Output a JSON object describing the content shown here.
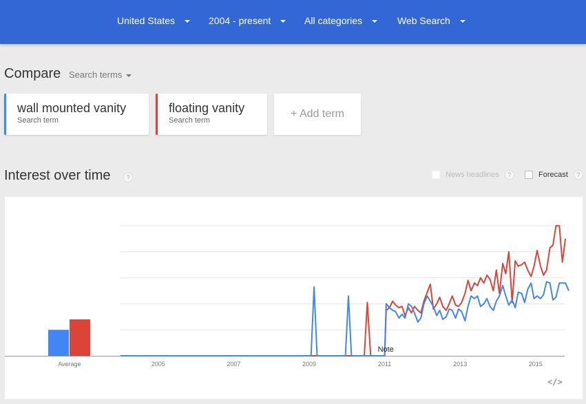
{
  "header": {
    "filters": [
      {
        "label": "United States",
        "name": "filter-region"
      },
      {
        "label": "2004 - present",
        "name": "filter-time"
      },
      {
        "label": "All categories",
        "name": "filter-category"
      },
      {
        "label": "Web Search",
        "name": "filter-property"
      }
    ],
    "background_color": "#3367d6"
  },
  "compare": {
    "title": "Compare",
    "type_label": "Search terms",
    "terms": [
      {
        "name": "wall mounted vanity",
        "sub": "Search term",
        "color": "#4285f4"
      },
      {
        "name": "floating vanity",
        "sub": "Search term",
        "color": "#db4437"
      }
    ],
    "add_term_label": "+ Add term"
  },
  "interest": {
    "title": "Interest over time",
    "help": "?",
    "news_headlines_label": "News headlines",
    "forecast_label": "Forecast",
    "embed_label": "</>",
    "note_label": "Note"
  },
  "chart_data": {
    "type": "line",
    "title": "Interest over time",
    "xlabel": "",
    "ylabel": "",
    "ylim": [
      0,
      100
    ],
    "x_start": 2004.0,
    "x_end": 2015.8,
    "xticks": [
      "2005",
      "2007",
      "2009",
      "2011",
      "2013",
      "2015"
    ],
    "xtick_values": [
      2005,
      2007,
      2009,
      2011,
      2013,
      2015
    ],
    "grid": true,
    "gridline_values": [
      20,
      40,
      60,
      80,
      100
    ],
    "average": {
      "label": "Average",
      "values": [
        {
          "name": "wall mounted vanity",
          "value": 20
        },
        {
          "name": "floating vanity",
          "value": 28
        }
      ]
    },
    "series": [
      {
        "name": "wall mounted vanity",
        "color": "#4285f4",
        "points": [
          [
            2004.0,
            0
          ],
          [
            2009.05,
            0
          ],
          [
            2009.13,
            53
          ],
          [
            2009.21,
            0
          ],
          [
            2009.96,
            0
          ],
          [
            2010.04,
            46
          ],
          [
            2010.12,
            0
          ],
          [
            2011.0,
            0
          ],
          [
            2011.04,
            40
          ],
          [
            2011.13,
            37
          ],
          [
            2011.21,
            35
          ],
          [
            2011.29,
            34
          ],
          [
            2011.38,
            29
          ],
          [
            2011.46,
            32
          ],
          [
            2011.54,
            29
          ],
          [
            2011.63,
            40
          ],
          [
            2011.71,
            38
          ],
          [
            2011.79,
            33
          ],
          [
            2011.88,
            26
          ],
          [
            2011.96,
            29
          ],
          [
            2012.04,
            40
          ],
          [
            2012.13,
            46
          ],
          [
            2012.21,
            42
          ],
          [
            2012.29,
            38
          ],
          [
            2012.38,
            31
          ],
          [
            2012.46,
            35
          ],
          [
            2012.54,
            28
          ],
          [
            2012.63,
            30
          ],
          [
            2012.71,
            36
          ],
          [
            2012.79,
            35
          ],
          [
            2012.88,
            29
          ],
          [
            2012.96,
            36
          ],
          [
            2013.04,
            34
          ],
          [
            2013.13,
            27
          ],
          [
            2013.21,
            38
          ],
          [
            2013.29,
            46
          ],
          [
            2013.38,
            44
          ],
          [
            2013.46,
            46
          ],
          [
            2013.54,
            38
          ],
          [
            2013.63,
            40
          ],
          [
            2013.71,
            44
          ],
          [
            2013.79,
            38
          ],
          [
            2013.88,
            35
          ],
          [
            2013.96,
            42
          ],
          [
            2014.04,
            46
          ],
          [
            2014.13,
            54
          ],
          [
            2014.21,
            46
          ],
          [
            2014.29,
            39
          ],
          [
            2014.38,
            43
          ],
          [
            2014.46,
            37
          ],
          [
            2014.54,
            49
          ],
          [
            2014.63,
            48
          ],
          [
            2014.71,
            41
          ],
          [
            2014.79,
            51
          ],
          [
            2014.88,
            56
          ],
          [
            2014.96,
            44
          ],
          [
            2015.04,
            46
          ],
          [
            2015.13,
            44
          ],
          [
            2015.21,
            47
          ],
          [
            2015.29,
            57
          ],
          [
            2015.38,
            56
          ],
          [
            2015.46,
            43
          ],
          [
            2015.54,
            45
          ],
          [
            2015.63,
            56
          ],
          [
            2015.71,
            56
          ],
          [
            2015.79,
            56
          ],
          [
            2015.88,
            50
          ]
        ]
      },
      {
        "name": "floating vanity",
        "color": "#db4437",
        "points": [
          [
            2004.0,
            0
          ],
          [
            2010.46,
            0
          ],
          [
            2010.54,
            41
          ],
          [
            2010.63,
            0
          ],
          [
            2011.0,
            0
          ],
          [
            2011.04,
            35
          ],
          [
            2011.13,
            37
          ],
          [
            2011.21,
            42
          ],
          [
            2011.29,
            39
          ],
          [
            2011.38,
            37
          ],
          [
            2011.46,
            38
          ],
          [
            2011.54,
            31
          ],
          [
            2011.63,
            37
          ],
          [
            2011.71,
            33
          ],
          [
            2011.79,
            38
          ],
          [
            2011.88,
            35
          ],
          [
            2011.96,
            33
          ],
          [
            2012.04,
            42
          ],
          [
            2012.13,
            49
          ],
          [
            2012.21,
            55
          ],
          [
            2012.29,
            36
          ],
          [
            2012.38,
            40
          ],
          [
            2012.46,
            45
          ],
          [
            2012.54,
            38
          ],
          [
            2012.63,
            35
          ],
          [
            2012.71,
            40
          ],
          [
            2012.79,
            46
          ],
          [
            2012.88,
            39
          ],
          [
            2012.96,
            38
          ],
          [
            2013.04,
            41
          ],
          [
            2013.13,
            48
          ],
          [
            2013.21,
            58
          ],
          [
            2013.29,
            50
          ],
          [
            2013.38,
            56
          ],
          [
            2013.46,
            54
          ],
          [
            2013.54,
            60
          ],
          [
            2013.63,
            56
          ],
          [
            2013.71,
            62
          ],
          [
            2013.79,
            59
          ],
          [
            2013.88,
            50
          ],
          [
            2013.96,
            66
          ],
          [
            2014.04,
            48
          ],
          [
            2014.13,
            71
          ],
          [
            2014.21,
            63
          ],
          [
            2014.29,
            80
          ],
          [
            2014.38,
            41
          ],
          [
            2014.46,
            73
          ],
          [
            2014.54,
            69
          ],
          [
            2014.63,
            70
          ],
          [
            2014.71,
            72
          ],
          [
            2014.79,
            66
          ],
          [
            2014.88,
            61
          ],
          [
            2014.96,
            69
          ],
          [
            2015.04,
            81
          ],
          [
            2015.13,
            69
          ],
          [
            2015.21,
            62
          ],
          [
            2015.29,
            66
          ],
          [
            2015.38,
            83
          ],
          [
            2015.46,
            85
          ],
          [
            2015.54,
            100
          ],
          [
            2015.63,
            100
          ],
          [
            2015.71,
            72
          ],
          [
            2015.79,
            90
          ]
        ]
      }
    ]
  }
}
